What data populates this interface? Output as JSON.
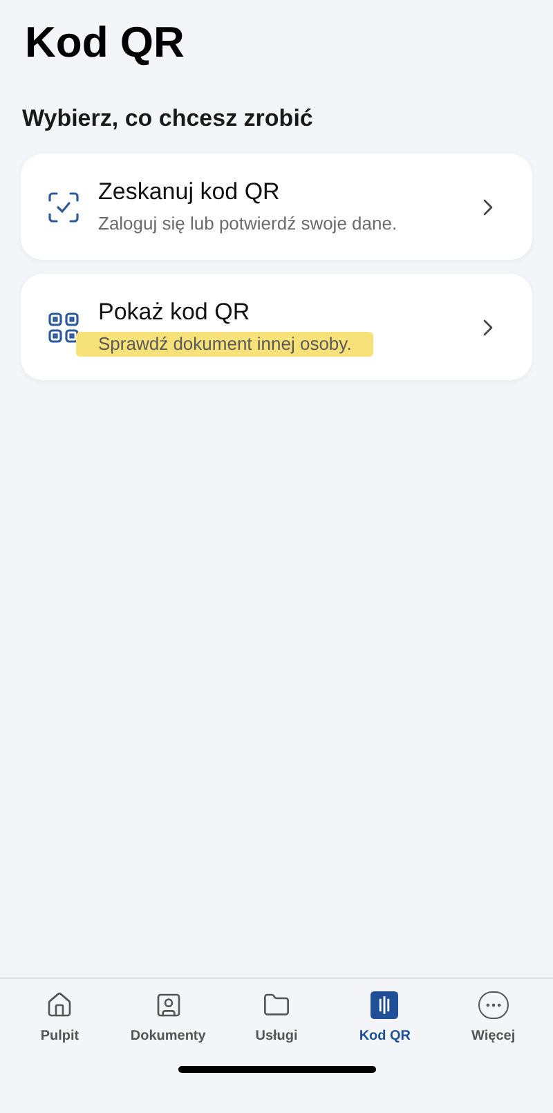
{
  "title": "Kod QR",
  "section_heading": "Wybierz, co chcesz zrobić",
  "options": [
    {
      "kind": "scan",
      "title": "Zeskanuj kod QR",
      "subtitle": "Zaloguj się lub potwierdź swoje dane.",
      "highlighted": false
    },
    {
      "kind": "show",
      "title": "Pokaż kod QR",
      "subtitle": "Sprawdź dokument innej osoby.",
      "highlighted": true
    }
  ],
  "tab_bar": [
    {
      "kind": "home",
      "label": "Pulpit",
      "selected": false
    },
    {
      "kind": "documents",
      "label": "Dokumenty",
      "selected": false
    },
    {
      "kind": "services",
      "label": "Usługi",
      "selected": false
    },
    {
      "kind": "qr",
      "label": "Kod QR",
      "selected": true
    },
    {
      "kind": "more",
      "label": "Więcej",
      "selected": false
    }
  ]
}
